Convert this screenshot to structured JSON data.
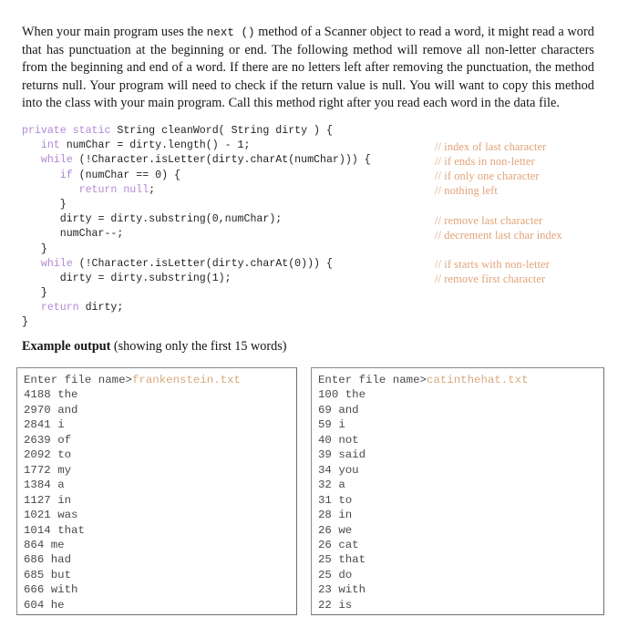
{
  "intro": {
    "part1": "When your main program uses the ",
    "mono1": "next ()",
    "part2": " method of a Scanner object to read a word, it might read a word that has punctuation at the beginning or end.  The following method will remove all non-letter characters from the beginning and end of a word.  If there are no letters left after removing the punctuation, the method returns null.  Your program will need to check if the return value is null.  You will want to copy this method into the class with your main program.  Call this method right after you read each word in the data file."
  },
  "code": {
    "language": "java",
    "keyword_color": "#b288d4",
    "comment_color": "#e2a277",
    "lines": [
      {
        "indent": "",
        "tokens": [
          {
            "t": "kw",
            "v": "private static"
          },
          {
            "t": "txt",
            "v": " String cleanWord( String dirty ) {"
          }
        ],
        "comment": ""
      },
      {
        "indent": "   ",
        "tokens": [
          {
            "t": "kw",
            "v": "int"
          },
          {
            "t": "txt",
            "v": " numChar = dirty.length() - 1;"
          }
        ],
        "comment": "// index of last character"
      },
      {
        "indent": "   ",
        "tokens": [
          {
            "t": "kw",
            "v": "while"
          },
          {
            "t": "txt",
            "v": " (!Character.isLetter(dirty.charAt(numChar))) {"
          }
        ],
        "comment": "// if ends in non-letter"
      },
      {
        "indent": "      ",
        "tokens": [
          {
            "t": "kw",
            "v": "if"
          },
          {
            "t": "txt",
            "v": " (numChar == 0) {"
          }
        ],
        "comment": "// if only one character"
      },
      {
        "indent": "         ",
        "tokens": [
          {
            "t": "kw",
            "v": "return null"
          },
          {
            "t": "txt",
            "v": ";"
          }
        ],
        "comment": "// nothing left"
      },
      {
        "indent": "      ",
        "tokens": [
          {
            "t": "txt",
            "v": "}"
          }
        ],
        "comment": ""
      },
      {
        "indent": "      ",
        "tokens": [
          {
            "t": "txt",
            "v": "dirty = dirty.substring(0,numChar);"
          }
        ],
        "comment": "// remove last character"
      },
      {
        "indent": "      ",
        "tokens": [
          {
            "t": "txt",
            "v": "numChar--;"
          }
        ],
        "comment": "// decrement last char index"
      },
      {
        "indent": "   ",
        "tokens": [
          {
            "t": "txt",
            "v": "}"
          }
        ],
        "comment": ""
      },
      {
        "indent": "   ",
        "tokens": [
          {
            "t": "kw",
            "v": "while"
          },
          {
            "t": "txt",
            "v": " (!Character.isLetter(dirty.charAt(0))) {"
          }
        ],
        "comment": "// if starts with non-letter"
      },
      {
        "indent": "      ",
        "tokens": [
          {
            "t": "txt",
            "v": "dirty = dirty.substring(1);"
          }
        ],
        "comment": "// remove first character"
      },
      {
        "indent": "   ",
        "tokens": [
          {
            "t": "txt",
            "v": "}"
          }
        ],
        "comment": ""
      },
      {
        "indent": "   ",
        "tokens": [
          {
            "t": "kw",
            "v": "return"
          },
          {
            "t": "txt",
            "v": " dirty;"
          }
        ],
        "comment": ""
      },
      {
        "indent": "",
        "tokens": [
          {
            "t": "txt",
            "v": "}"
          }
        ],
        "comment": ""
      }
    ]
  },
  "example_heading": {
    "bold": "Example output",
    "rest": " (showing only the first 15 words)"
  },
  "output_boxes": [
    {
      "id": "left",
      "prompt": "Enter file name>",
      "filename": "frankenstein.txt",
      "rows": [
        {
          "count": "4188",
          "word": "the"
        },
        {
          "count": "2970",
          "word": "and"
        },
        {
          "count": "2841",
          "word": "i"
        },
        {
          "count": "2639",
          "word": "of"
        },
        {
          "count": "2092",
          "word": "to"
        },
        {
          "count": "1772",
          "word": "my"
        },
        {
          "count": "1384",
          "word": "a"
        },
        {
          "count": "1127",
          "word": "in"
        },
        {
          "count": "1021",
          "word": "was"
        },
        {
          "count": "1014",
          "word": "that"
        },
        {
          "count": "864",
          "word": "me"
        },
        {
          "count": "686",
          "word": "had"
        },
        {
          "count": "685",
          "word": "but"
        },
        {
          "count": "666",
          "word": "with"
        },
        {
          "count": "604",
          "word": "he"
        }
      ]
    },
    {
      "id": "right",
      "prompt": "Enter file name>",
      "filename": "catinthehat.txt",
      "rows": [
        {
          "count": "100",
          "word": "the"
        },
        {
          "count": "69",
          "word": "and"
        },
        {
          "count": "59",
          "word": "i"
        },
        {
          "count": "40",
          "word": "not"
        },
        {
          "count": "39",
          "word": "said"
        },
        {
          "count": "34",
          "word": "you"
        },
        {
          "count": "32",
          "word": "a"
        },
        {
          "count": "31",
          "word": "to"
        },
        {
          "count": "28",
          "word": "in"
        },
        {
          "count": "26",
          "word": "we"
        },
        {
          "count": "26",
          "word": "cat"
        },
        {
          "count": "25",
          "word": "that"
        },
        {
          "count": "25",
          "word": "do"
        },
        {
          "count": "23",
          "word": "with"
        },
        {
          "count": "22",
          "word": "is"
        }
      ]
    }
  ]
}
